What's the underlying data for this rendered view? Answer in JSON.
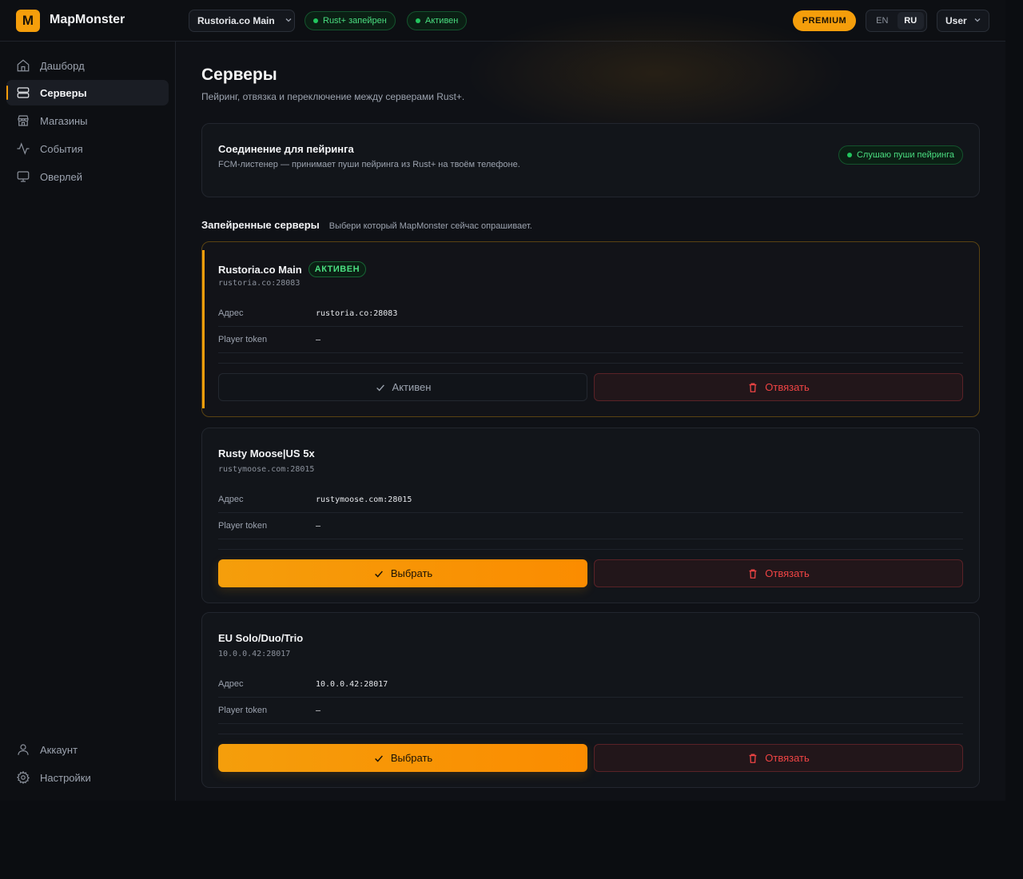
{
  "app": {
    "logo_letter": "M",
    "name": "MapMonster"
  },
  "topbar": {
    "server_select": "Rustoria.co Main",
    "pills": [
      "Rust+ запейрен",
      "Активен"
    ],
    "premium": "PREMIUM",
    "languages": [
      "EN",
      "RU"
    ],
    "active_language": "RU",
    "user": "User"
  },
  "sidebar": {
    "items": [
      {
        "label": "Дашборд",
        "icon": "home-icon"
      },
      {
        "label": "Серверы",
        "icon": "server-icon",
        "active": true
      },
      {
        "label": "Магазины",
        "icon": "store-icon"
      },
      {
        "label": "События",
        "icon": "activity-icon"
      },
      {
        "label": "Оверлей",
        "icon": "monitor-icon"
      }
    ],
    "bottom_items": [
      {
        "label": "Аккаунт",
        "icon": "user-icon"
      },
      {
        "label": "Настройки",
        "icon": "gear-icon"
      }
    ]
  },
  "page": {
    "title": "Серверы",
    "subtitle": "Пейринг, отвязка и переключение между серверами Rust+."
  },
  "pairing": {
    "title": "Соединение для пейринга",
    "description": "FCM-листенер — принимает пуши пейринга из Rust+ на твоём телефоне.",
    "status": "Слушаю пуши пейринга"
  },
  "paired": {
    "title": "Запейренные серверы",
    "subtitle": "Выбери который MapMonster сейчас опрашивает."
  },
  "labels": {
    "address": "Адрес",
    "player_token": "Player token",
    "select": "Выбрать",
    "active": "Активен",
    "unbind": "Отвязать",
    "active_badge": "АКТИВЕН"
  },
  "servers": [
    {
      "name": "Rustoria.co Main",
      "host": "rustoria.co:28083",
      "address": "rustoria.co:28083",
      "player_token": "—",
      "active": true
    },
    {
      "name": "Rusty Moose|US 5x",
      "host": "rustymoose.com:28015",
      "address": "rustymoose.com:28015",
      "player_token": "—",
      "active": false
    },
    {
      "name": "EU Solo/Duo/Trio",
      "host": "10.0.0.42:28017",
      "address": "10.0.0.42:28017",
      "player_token": "—",
      "active": false
    }
  ],
  "colors": {
    "accent": "#f59e0b",
    "success": "#22c55e",
    "danger": "#ef4444",
    "background": "#0f1116"
  }
}
